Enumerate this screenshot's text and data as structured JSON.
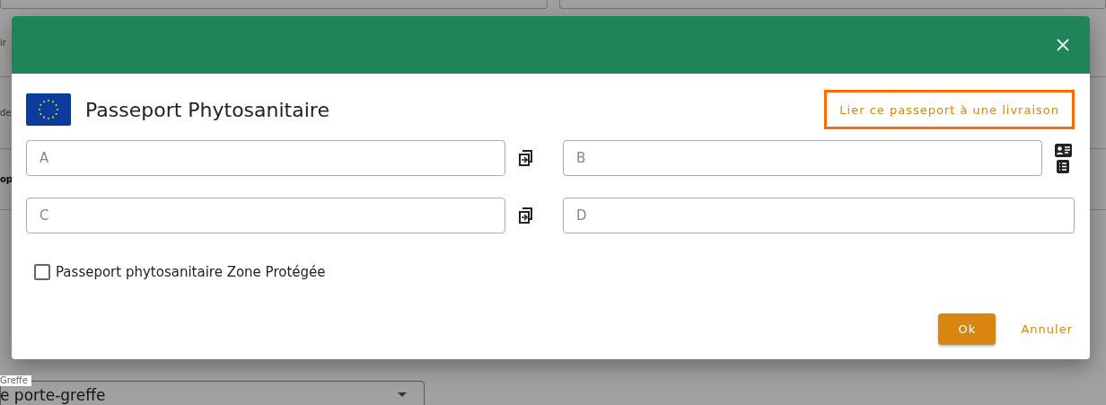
{
  "background": {
    "rows": [
      {
        "kind": "field",
        "text": "ir"
      },
      {
        "kind": "field",
        "text": "de"
      },
      {
        "kind": "heading",
        "text": "op"
      }
    ],
    "select": {
      "label": "Greffe",
      "value": "e porte-greffe"
    }
  },
  "dialog": {
    "title": "Passeport Phytosanitaire",
    "link_button": "Lier ce passeport à une livraison",
    "fields": [
      {
        "placeholder": "A",
        "kind": "copy"
      },
      {
        "placeholder": "B",
        "kind": "lookup"
      },
      {
        "placeholder": "C",
        "kind": "copy"
      },
      {
        "placeholder": "D",
        "kind": "plain"
      }
    ],
    "checkbox": {
      "label": "Passeport phytosanitaire Zone Protégée",
      "checked": false
    },
    "buttons": [
      {
        "label": "Ok",
        "kind": "primary"
      },
      {
        "label": "Annuler",
        "kind": "text"
      }
    ]
  }
}
